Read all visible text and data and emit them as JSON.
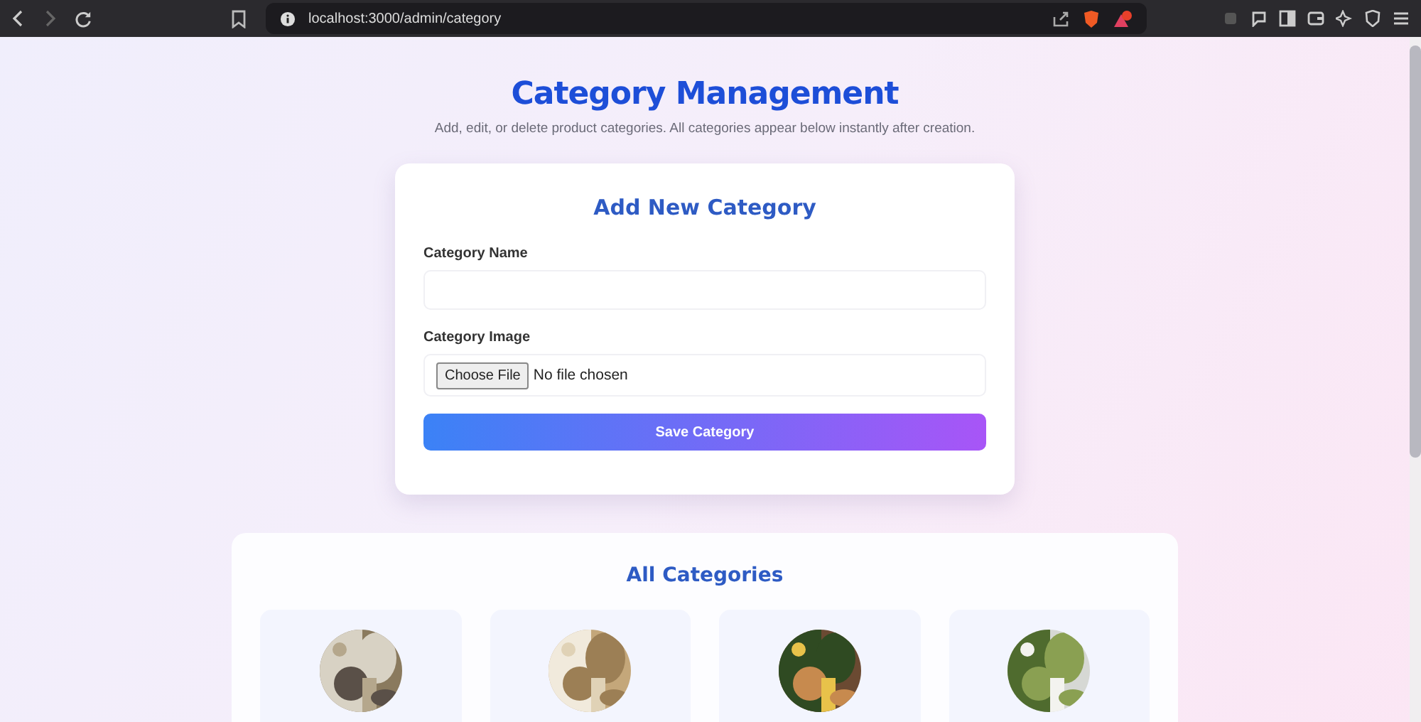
{
  "browser": {
    "url": "localhost:3000/admin/category"
  },
  "page": {
    "title": "Category Management",
    "subtitle": "Add, edit, or delete product categories. All categories appear below instantly after creation."
  },
  "form": {
    "heading": "Add New Category",
    "fields": [
      {
        "kind": "text",
        "label": "Category Name"
      },
      {
        "kind": "file",
        "label": "Category Image",
        "button": "Choose File",
        "status": "No file chosen"
      }
    ],
    "submit": "Save Category"
  },
  "categories": {
    "heading": "All Categories"
  }
}
